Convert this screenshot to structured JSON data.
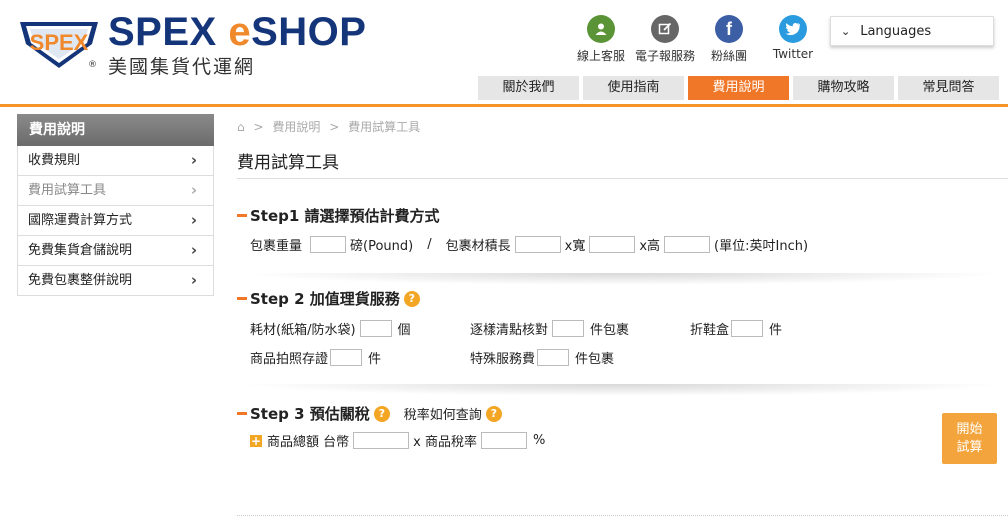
{
  "brand": {
    "logo_mark": "SPEX",
    "name_part1": "SPEX ",
    "name_e": "e",
    "name_part2": "SHOP",
    "subtitle": "美國集貨代運網",
    "reg": "®"
  },
  "quick_links": [
    {
      "label": "線上客服",
      "icon": "user-support-icon"
    },
    {
      "label": "電子報服務",
      "icon": "edit-icon"
    },
    {
      "label": "粉絲團",
      "icon": "facebook-icon"
    },
    {
      "label": "Twitter",
      "icon": "twitter-icon"
    }
  ],
  "languages": {
    "label": "Languages"
  },
  "topnav": [
    {
      "label": "關於我們"
    },
    {
      "label": "使用指南"
    },
    {
      "label": "費用說明",
      "active": true
    },
    {
      "label": "購物攻略"
    },
    {
      "label": "常見問答"
    }
  ],
  "sidebar": {
    "title": "費用說明",
    "items": [
      {
        "label": "收費規則"
      },
      {
        "label": "費用試算工具",
        "current": true
      },
      {
        "label": "國際運費計算方式"
      },
      {
        "label": "免費集貨倉儲說明"
      },
      {
        "label": "免費包裹整併說明"
      }
    ]
  },
  "breadcrumb": {
    "home": "⌂",
    "sep": ">",
    "level1": "費用說明",
    "level2": "費用試算工具"
  },
  "page_title": "費用試算工具",
  "step1": {
    "title": "Step1  請選擇預估計費方式",
    "weight_label": "包裹重量",
    "weight_unit": "磅(Pound)",
    "slash": "/",
    "volume_label": "包裹材積長",
    "width_label": "x寬",
    "height_label": "x高",
    "unit_note": "(單位:英吋Inch)"
  },
  "step2": {
    "title": "Step 2  加值理貨服務",
    "material_label": "耗材(紙箱/防水袋)",
    "material_unit": "個",
    "check_label": "逐樣清點核對",
    "check_unit": "件包裹",
    "shoebox_label": "折鞋盒",
    "shoebox_unit": "件",
    "photo_label": "商品拍照存證",
    "photo_unit": "件",
    "special_label": "特殊服務費",
    "special_unit": "件包裹"
  },
  "step3": {
    "title": "Step 3  預估關稅",
    "tax_query": "稅率如何查詢",
    "total_label": "商品總額 台幣",
    "tax_rate_label": "x 商品稅率",
    "percent": "%"
  },
  "calc_button": {
    "line1": "開始",
    "line2": "試算"
  },
  "colors": {
    "accent": "#ef7727",
    "brand_blue": "#15357a",
    "help": "#f3a624"
  }
}
